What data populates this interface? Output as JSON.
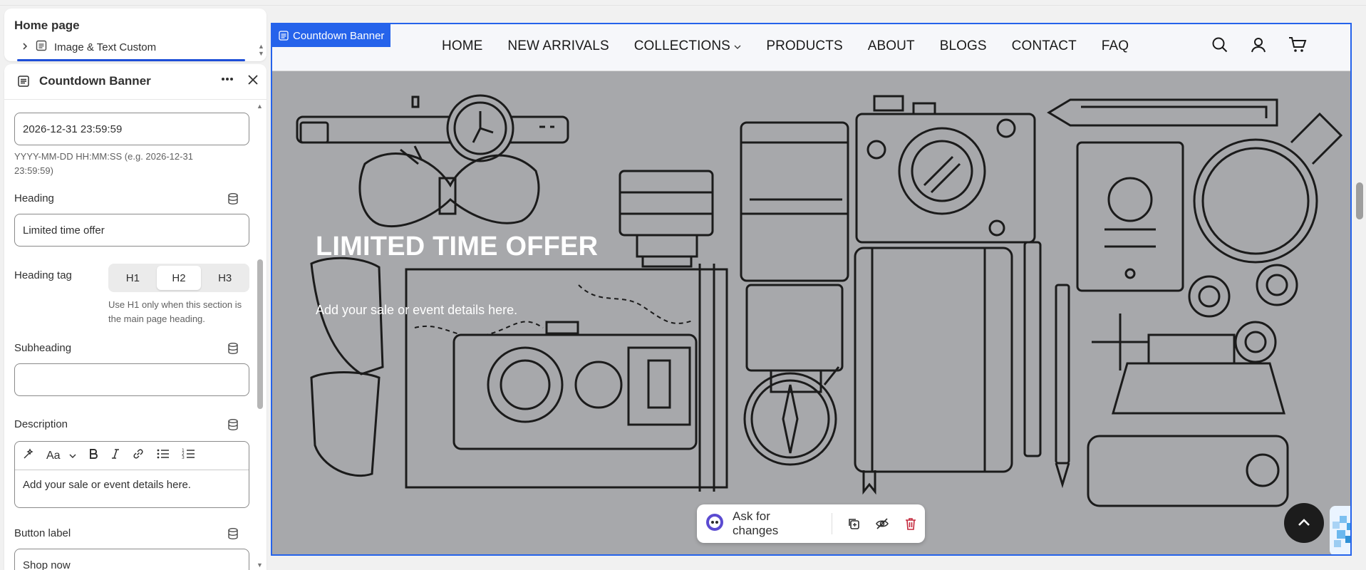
{
  "sidebar": {
    "page_title": "Home page",
    "tree_item": "Image & Text Custom",
    "section_title": "Countdown Banner",
    "end_date": {
      "value": "2026-12-31 23:59:59",
      "help": "YYYY-MM-DD HH:MM:SS (e.g. 2026-12-31 23:59:59)"
    },
    "heading": {
      "label": "Heading",
      "value": "Limited time offer"
    },
    "heading_tag": {
      "label": "Heading tag",
      "options": [
        "H1",
        "H2",
        "H3"
      ],
      "selected": "H2",
      "help": "Use H1 only when this section is the main page heading."
    },
    "subheading": {
      "label": "Subheading",
      "value": ""
    },
    "description": {
      "label": "Description",
      "value": "Add your sale or event details here.",
      "font_button": "Aa"
    },
    "button_label": {
      "label": "Button label",
      "value": "Shop now"
    }
  },
  "preview": {
    "section_tag": "Countdown Banner",
    "nav": [
      "HOME",
      "NEW ARRIVALS",
      "COLLECTIONS",
      "PRODUCTS",
      "ABOUT",
      "BLOGS",
      "CONTACT",
      "FAQ"
    ],
    "hero_heading": "LIMITED TIME OFFER",
    "hero_text": "Add your sale or event details here.",
    "ask_label": "Ask for changes"
  },
  "colors": {
    "accent": "#2563eb",
    "hero_bg": "#a7a8ab",
    "danger": "#c4283c"
  }
}
